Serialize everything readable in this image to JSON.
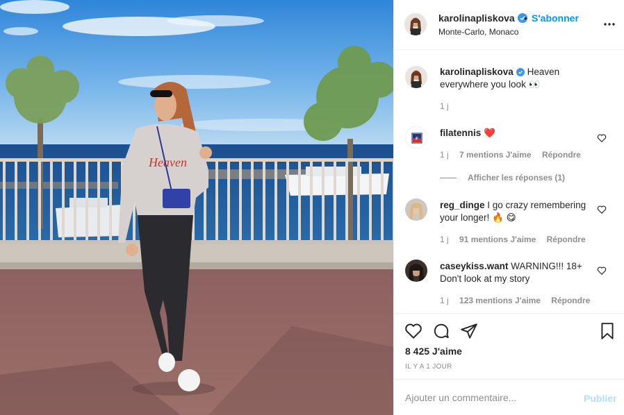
{
  "post": {
    "username": "karolinapliskova",
    "follow_label": "S'abonner",
    "separator": "•",
    "location": "Monte-Carlo, Monaco",
    "more_icon": "more-horizontal-icon",
    "verified_icon": "verified-badge-icon",
    "caption": {
      "username": "karolinapliskova",
      "text": "Heaven everywhere you look 👀",
      "time": "1 j"
    },
    "comments": [
      {
        "username": "filatennis",
        "text": "❤️",
        "time": "1 j",
        "likes": "7 mentions J'aime",
        "reply": "Répondre",
        "avatar": "fila-logo"
      },
      {
        "username": "reg_dinge",
        "text": "I go crazy remembering your longer! 🔥 😋",
        "time": "1 j",
        "likes": "91 mentions J'aime",
        "reply": "Répondre",
        "avatar": "user-photo"
      },
      {
        "username": "caseykiss.want",
        "text": "WARNING!!! 18+ Don't look at my story",
        "time": "1 j",
        "likes": "123 mentions J'aime",
        "reply": "Répondre",
        "avatar": "user-photo"
      }
    ],
    "view_replies": "Afficher les réponses (1)",
    "like_count": "8 425 J'aime",
    "posted_time": "IL Y A 1 JOUR",
    "comment_placeholder": "Ajouter un commentaire...",
    "publish_label": "Publier",
    "colors": {
      "link_blue": "#0095f6",
      "publish_disabled": "#b2dffc",
      "heart_red": "#ed4956",
      "text": "#262626",
      "muted": "#8e8e8e"
    },
    "action_icons": [
      "heart-icon",
      "comment-icon",
      "share-icon",
      "bookmark-icon"
    ]
  }
}
